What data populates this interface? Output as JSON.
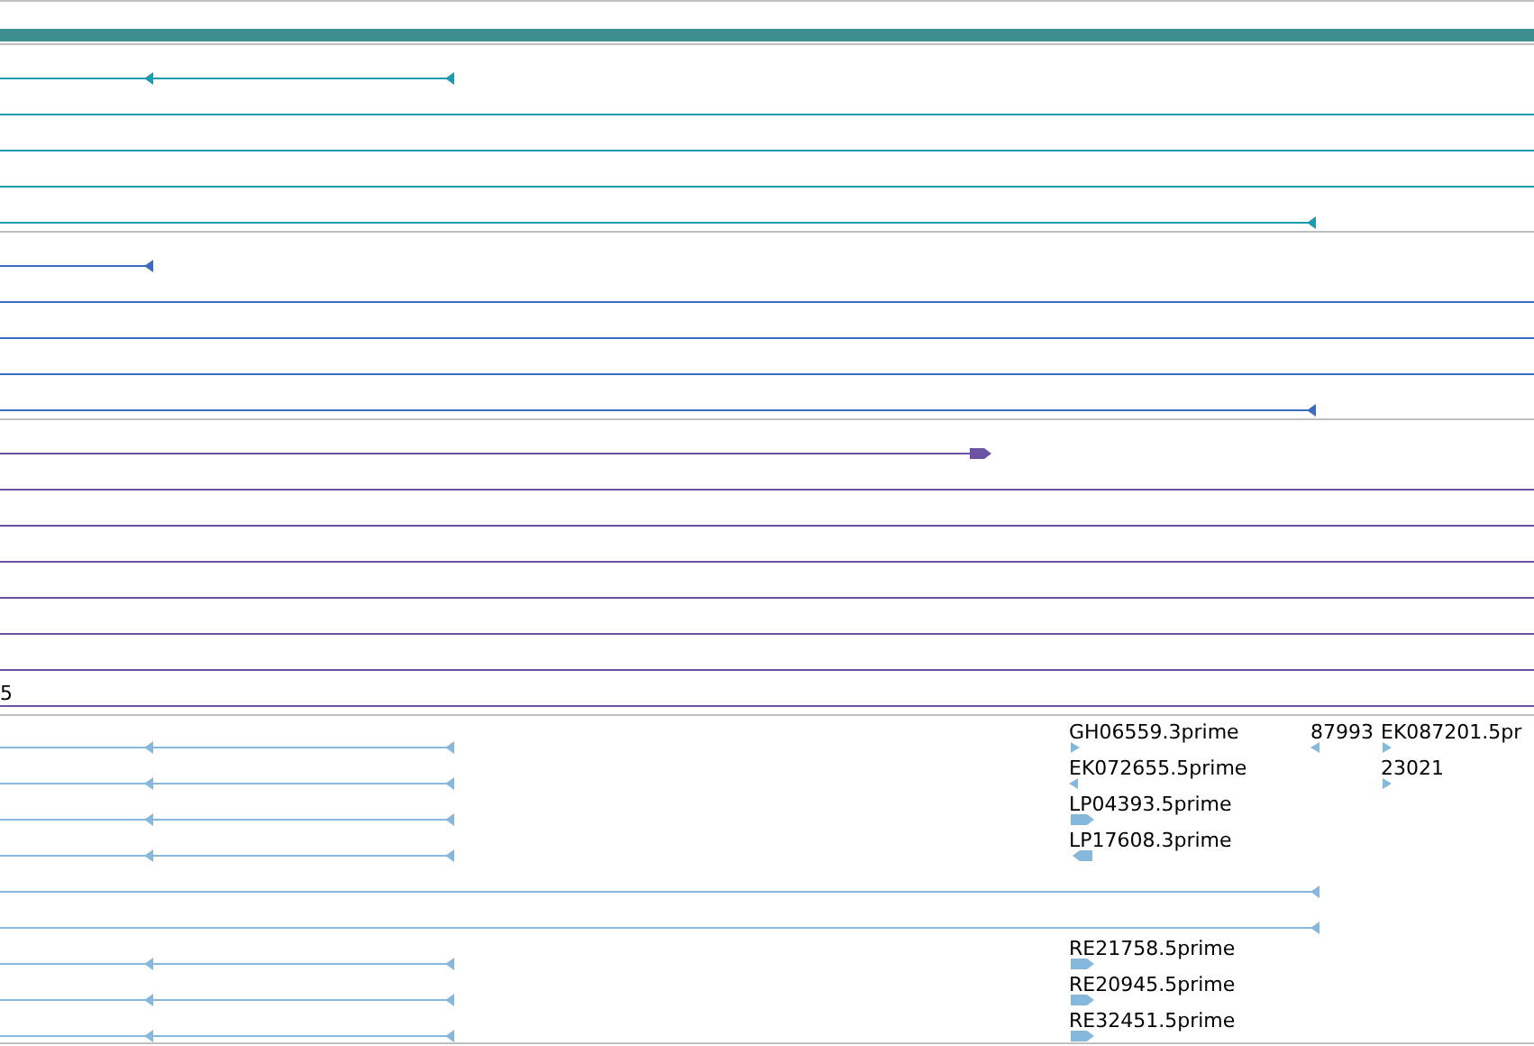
{
  "tracks": [
    {
      "color": "#1a9bb0"
    },
    {
      "color": "#3a6cc0"
    },
    {
      "color": "#6b52a3",
      "labels": [
        "5"
      ]
    },
    {
      "color": "#86b8dc",
      "labels": [
        "GH06559.3prime",
        "87993",
        "EK087201.5pr",
        "EK072655.5prime",
        "23021",
        "LP04393.5prime",
        "LP17608.3prime",
        "RE21758.5prime",
        "RE20945.5prime",
        "RE32451.5prime"
      ]
    }
  ]
}
